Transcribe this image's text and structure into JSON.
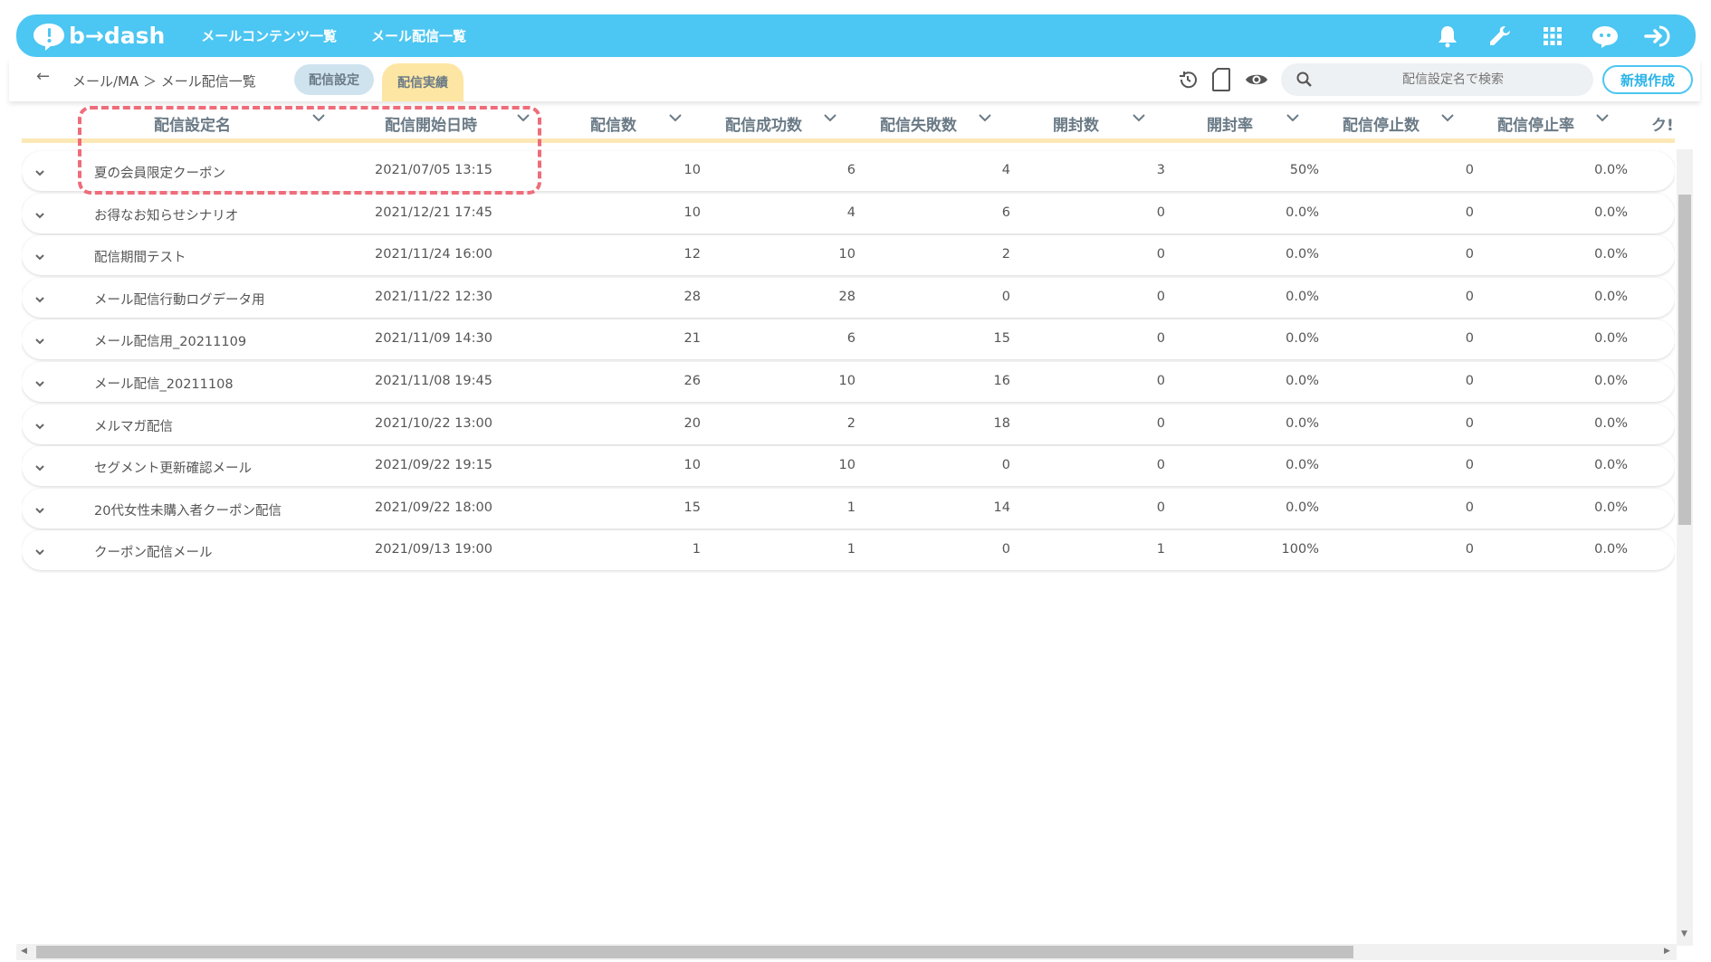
{
  "header": {
    "logo_text": "b→dash",
    "nav": [
      "メールコンテンツ一覧",
      "メール配信一覧"
    ],
    "icons": [
      "bell-icon",
      "wrench-icon",
      "apps-grid-icon",
      "support-chat-icon",
      "logout-icon"
    ]
  },
  "subheader": {
    "back_label": "←",
    "breadcrumb": "メール/MA ＞ メール配信一覧",
    "tabs": [
      "配信設定",
      "配信実績"
    ],
    "search_placeholder": "配信設定名で検索",
    "new_button": "新規作成",
    "icons": [
      "history-icon",
      "copy-icon",
      "eye-icon",
      "search-icon"
    ]
  },
  "table": {
    "columns": [
      "配信設定名",
      "配信開始日時",
      "配信数",
      "配信成功数",
      "配信失敗数",
      "開封数",
      "開封率",
      "配信停止数",
      "配信停止率",
      "ク!"
    ],
    "rows": [
      {
        "name": "夏の会員限定クーポン",
        "start": "2021/07/05 13:15",
        "sent": "10",
        "success": "6",
        "fail": "4",
        "opens": "3",
        "open_rate": "50%",
        "unsub": "0",
        "unsub_rate": "0.0%"
      },
      {
        "name": "お得なお知らせシナリオ",
        "start": "2021/12/21 17:45",
        "sent": "10",
        "success": "4",
        "fail": "6",
        "opens": "0",
        "open_rate": "0.0%",
        "unsub": "0",
        "unsub_rate": "0.0%"
      },
      {
        "name": "配信期間テスト",
        "start": "2021/11/24 16:00",
        "sent": "12",
        "success": "10",
        "fail": "2",
        "opens": "0",
        "open_rate": "0.0%",
        "unsub": "0",
        "unsub_rate": "0.0%"
      },
      {
        "name": "メール配信行動ログデータ用",
        "start": "2021/11/22 12:30",
        "sent": "28",
        "success": "28",
        "fail": "0",
        "opens": "0",
        "open_rate": "0.0%",
        "unsub": "0",
        "unsub_rate": "0.0%"
      },
      {
        "name": "メール配信用_20211109",
        "start": "2021/11/09 14:30",
        "sent": "21",
        "success": "6",
        "fail": "15",
        "opens": "0",
        "open_rate": "0.0%",
        "unsub": "0",
        "unsub_rate": "0.0%"
      },
      {
        "name": "メール配信_20211108",
        "start": "2021/11/08 19:45",
        "sent": "26",
        "success": "10",
        "fail": "16",
        "opens": "0",
        "open_rate": "0.0%",
        "unsub": "0",
        "unsub_rate": "0.0%"
      },
      {
        "name": "メルマガ配信",
        "start": "2021/10/22 13:00",
        "sent": "20",
        "success": "2",
        "fail": "18",
        "opens": "0",
        "open_rate": "0.0%",
        "unsub": "0",
        "unsub_rate": "0.0%"
      },
      {
        "name": "セグメント更新確認メール",
        "start": "2021/09/22 19:15",
        "sent": "10",
        "success": "10",
        "fail": "0",
        "opens": "0",
        "open_rate": "0.0%",
        "unsub": "0",
        "unsub_rate": "0.0%"
      },
      {
        "name": "20代女性未購入者クーポン配信",
        "start": "2021/09/22 18:00",
        "sent": "15",
        "success": "1",
        "fail": "14",
        "opens": "0",
        "open_rate": "0.0%",
        "unsub": "0",
        "unsub_rate": "0.0%"
      },
      {
        "name": "クーポン配信メール",
        "start": "2021/09/13 19:00",
        "sent": "1",
        "success": "1",
        "fail": "0",
        "opens": "1",
        "open_rate": "100%",
        "unsub": "0",
        "unsub_rate": "0.0%"
      }
    ]
  },
  "colors": {
    "header_bg": "#4cc6f2",
    "tab_active_bg": "#fde6a3",
    "tab_inactive_bg": "#cfe3ef",
    "highlight": "#ef6c7a"
  }
}
